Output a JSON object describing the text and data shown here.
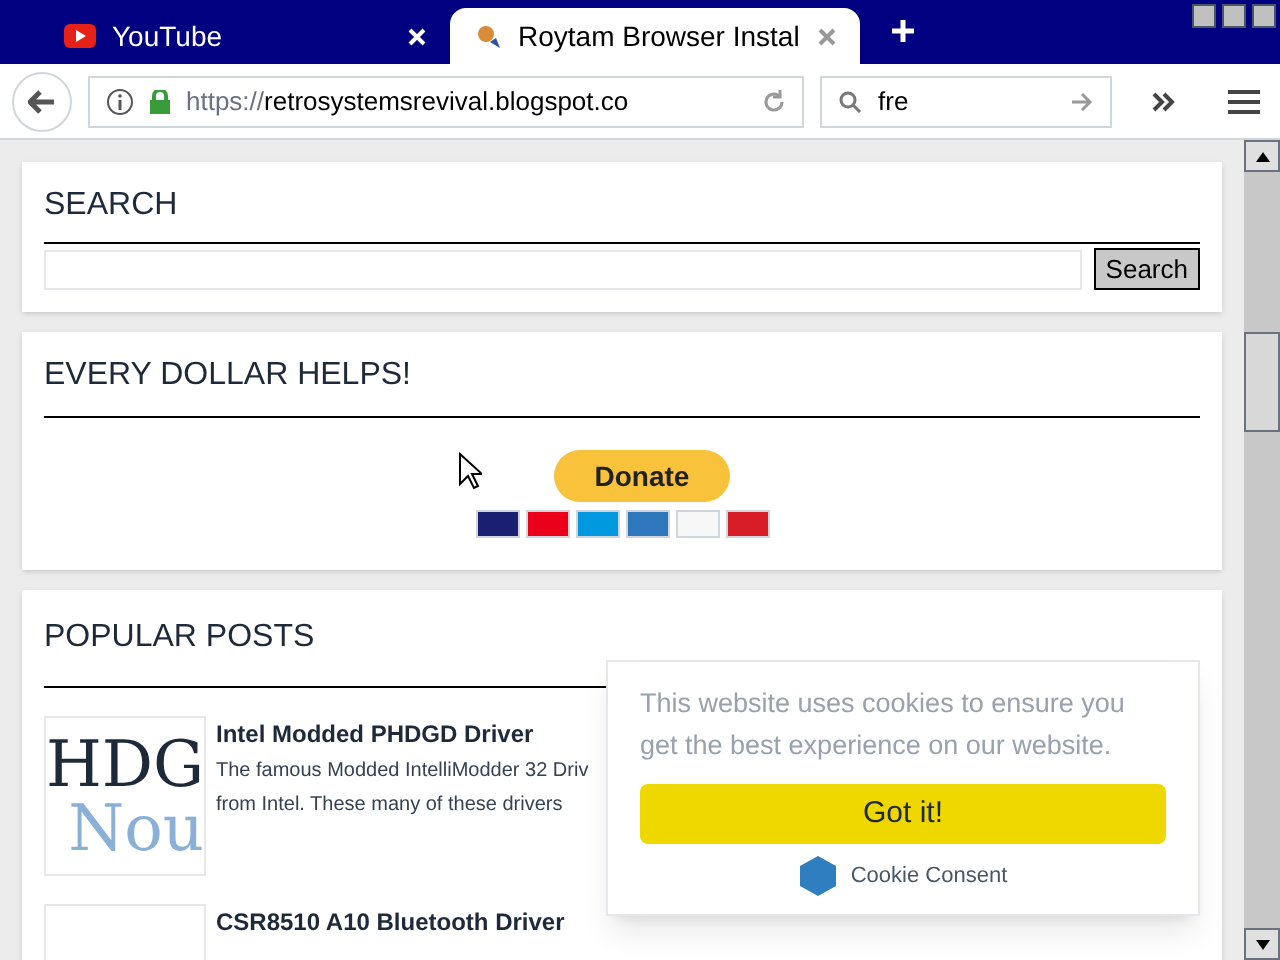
{
  "tabs": [
    {
      "title": "YouTube",
      "selected": false
    },
    {
      "title": "Roytam Browser Instal",
      "selected": true
    }
  ],
  "address_bar": {
    "url_prefix": "https://",
    "url_host": "retrosystemsrevival.blogspot.co"
  },
  "search_bar": {
    "value": "fre"
  },
  "widgets": {
    "search": {
      "title": "SEARCH",
      "button": "Search"
    },
    "donate": {
      "title": "EVERY DOLLAR HELPS!",
      "button": "Donate"
    },
    "popular_posts": {
      "title": "POPULAR POSTS",
      "posts": [
        {
          "title": "Intel Modded PHDGD Driver",
          "thumb_lines": [
            "HDG",
            "Nou"
          ],
          "excerpt_lines": [
            "The famous Modded IntelliModder 32 Driv",
            "from Intel. These many of these drivers"
          ]
        },
        {
          "title": "CSR8510 A10 Bluetooth Driver"
        }
      ]
    }
  },
  "cookie_popup": {
    "message": "This website uses cookies to ensure you get the best experience on our website.",
    "button": "Got it!",
    "brand": "Cookie Consent"
  }
}
